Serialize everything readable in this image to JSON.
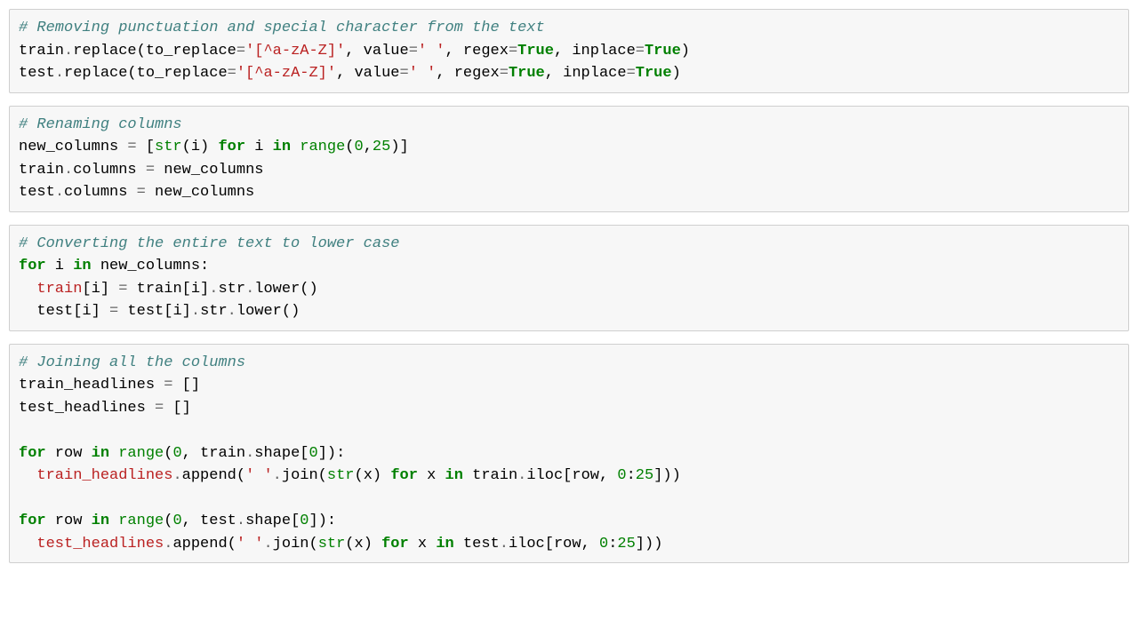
{
  "cells": [
    {
      "comment": "# Removing punctuation and special character from the text",
      "lines": [
        [
          {
            "t": "n",
            "v": "train"
          },
          {
            "t": "o",
            "v": "."
          },
          {
            "t": "n",
            "v": "replace(to_replace"
          },
          {
            "t": "o",
            "v": "="
          },
          {
            "t": "s",
            "v": "'[^a-zA-Z]'"
          },
          {
            "t": "n",
            "v": ", value"
          },
          {
            "t": "o",
            "v": "="
          },
          {
            "t": "s",
            "v": "' '"
          },
          {
            "t": "n",
            "v": ", regex"
          },
          {
            "t": "o",
            "v": "="
          },
          {
            "t": "kc",
            "v": "True"
          },
          {
            "t": "n",
            "v": ", inplace"
          },
          {
            "t": "o",
            "v": "="
          },
          {
            "t": "kc",
            "v": "True"
          },
          {
            "t": "n",
            "v": ")"
          }
        ],
        [
          {
            "t": "n",
            "v": "test"
          },
          {
            "t": "o",
            "v": "."
          },
          {
            "t": "n",
            "v": "replace(to_replace"
          },
          {
            "t": "o",
            "v": "="
          },
          {
            "t": "s",
            "v": "'[^a-zA-Z]'"
          },
          {
            "t": "n",
            "v": ", value"
          },
          {
            "t": "o",
            "v": "="
          },
          {
            "t": "s",
            "v": "' '"
          },
          {
            "t": "n",
            "v": ", regex"
          },
          {
            "t": "o",
            "v": "="
          },
          {
            "t": "kc",
            "v": "True"
          },
          {
            "t": "n",
            "v": ", inplace"
          },
          {
            "t": "o",
            "v": "="
          },
          {
            "t": "kc",
            "v": "True"
          },
          {
            "t": "n",
            "v": ")"
          }
        ]
      ]
    },
    {
      "comment": "# Renaming columns",
      "lines": [
        [
          {
            "t": "n",
            "v": "new_columns "
          },
          {
            "t": "o",
            "v": "="
          },
          {
            "t": "n",
            "v": " ["
          },
          {
            "t": "nb",
            "v": "str"
          },
          {
            "t": "n",
            "v": "(i) "
          },
          {
            "t": "k",
            "v": "for"
          },
          {
            "t": "n",
            "v": " i "
          },
          {
            "t": "k",
            "v": "in"
          },
          {
            "t": "n",
            "v": " "
          },
          {
            "t": "nb",
            "v": "range"
          },
          {
            "t": "n",
            "v": "("
          },
          {
            "t": "mi",
            "v": "0"
          },
          {
            "t": "n",
            "v": ","
          },
          {
            "t": "mi",
            "v": "25"
          },
          {
            "t": "n",
            "v": ")]"
          }
        ],
        [
          {
            "t": "n",
            "v": "train"
          },
          {
            "t": "o",
            "v": "."
          },
          {
            "t": "n",
            "v": "columns "
          },
          {
            "t": "o",
            "v": "="
          },
          {
            "t": "n",
            "v": " new_columns"
          }
        ],
        [
          {
            "t": "n",
            "v": "test"
          },
          {
            "t": "o",
            "v": "."
          },
          {
            "t": "n",
            "v": "columns "
          },
          {
            "t": "o",
            "v": "="
          },
          {
            "t": "n",
            "v": " new_columns"
          }
        ]
      ]
    },
    {
      "comment": "# Converting the entire text to lower case",
      "lines": [
        [
          {
            "t": "k",
            "v": "for"
          },
          {
            "t": "n",
            "v": " i "
          },
          {
            "t": "k",
            "v": "in"
          },
          {
            "t": "n",
            "v": " new_columns:"
          }
        ],
        [
          {
            "t": "n",
            "v": "  "
          },
          {
            "t": "err",
            "v": "train"
          },
          {
            "t": "n",
            "v": "[i] "
          },
          {
            "t": "o",
            "v": "="
          },
          {
            "t": "n",
            "v": " train[i]"
          },
          {
            "t": "o",
            "v": "."
          },
          {
            "t": "n",
            "v": "str"
          },
          {
            "t": "o",
            "v": "."
          },
          {
            "t": "n",
            "v": "lower()"
          }
        ],
        [
          {
            "t": "n",
            "v": "  test[i] "
          },
          {
            "t": "o",
            "v": "="
          },
          {
            "t": "n",
            "v": " test[i]"
          },
          {
            "t": "o",
            "v": "."
          },
          {
            "t": "n",
            "v": "str"
          },
          {
            "t": "o",
            "v": "."
          },
          {
            "t": "n",
            "v": "lower()"
          }
        ]
      ]
    },
    {
      "comment": "# Joining all the columns",
      "lines": [
        [
          {
            "t": "n",
            "v": "train_headlines "
          },
          {
            "t": "o",
            "v": "="
          },
          {
            "t": "n",
            "v": " []"
          }
        ],
        [
          {
            "t": "n",
            "v": "test_headlines "
          },
          {
            "t": "o",
            "v": "="
          },
          {
            "t": "n",
            "v": " []"
          }
        ],
        [],
        [
          {
            "t": "k",
            "v": "for"
          },
          {
            "t": "n",
            "v": " row "
          },
          {
            "t": "k",
            "v": "in"
          },
          {
            "t": "n",
            "v": " "
          },
          {
            "t": "nb",
            "v": "range"
          },
          {
            "t": "n",
            "v": "("
          },
          {
            "t": "mi",
            "v": "0"
          },
          {
            "t": "n",
            "v": ", train"
          },
          {
            "t": "o",
            "v": "."
          },
          {
            "t": "n",
            "v": "shape["
          },
          {
            "t": "mi",
            "v": "0"
          },
          {
            "t": "n",
            "v": "]):"
          }
        ],
        [
          {
            "t": "n",
            "v": "  "
          },
          {
            "t": "err",
            "v": "train_headlines"
          },
          {
            "t": "o",
            "v": "."
          },
          {
            "t": "n",
            "v": "append("
          },
          {
            "t": "s",
            "v": "' '"
          },
          {
            "t": "o",
            "v": "."
          },
          {
            "t": "n",
            "v": "join("
          },
          {
            "t": "nb",
            "v": "str"
          },
          {
            "t": "n",
            "v": "(x) "
          },
          {
            "t": "k",
            "v": "for"
          },
          {
            "t": "n",
            "v": " x "
          },
          {
            "t": "k",
            "v": "in"
          },
          {
            "t": "n",
            "v": " train"
          },
          {
            "t": "o",
            "v": "."
          },
          {
            "t": "n",
            "v": "iloc[row, "
          },
          {
            "t": "mi",
            "v": "0"
          },
          {
            "t": "n",
            "v": ":"
          },
          {
            "t": "mi",
            "v": "25"
          },
          {
            "t": "n",
            "v": "]))"
          }
        ],
        [],
        [
          {
            "t": "k",
            "v": "for"
          },
          {
            "t": "n",
            "v": " row "
          },
          {
            "t": "k",
            "v": "in"
          },
          {
            "t": "n",
            "v": " "
          },
          {
            "t": "nb",
            "v": "range"
          },
          {
            "t": "n",
            "v": "("
          },
          {
            "t": "mi",
            "v": "0"
          },
          {
            "t": "n",
            "v": ", test"
          },
          {
            "t": "o",
            "v": "."
          },
          {
            "t": "n",
            "v": "shape["
          },
          {
            "t": "mi",
            "v": "0"
          },
          {
            "t": "n",
            "v": "]):"
          }
        ],
        [
          {
            "t": "n",
            "v": "  "
          },
          {
            "t": "err",
            "v": "test_headlines"
          },
          {
            "t": "o",
            "v": "."
          },
          {
            "t": "n",
            "v": "append("
          },
          {
            "t": "s",
            "v": "' '"
          },
          {
            "t": "o",
            "v": "."
          },
          {
            "t": "n",
            "v": "join("
          },
          {
            "t": "nb",
            "v": "str"
          },
          {
            "t": "n",
            "v": "(x) "
          },
          {
            "t": "k",
            "v": "for"
          },
          {
            "t": "n",
            "v": " x "
          },
          {
            "t": "k",
            "v": "in"
          },
          {
            "t": "n",
            "v": " test"
          },
          {
            "t": "o",
            "v": "."
          },
          {
            "t": "n",
            "v": "iloc[row, "
          },
          {
            "t": "mi",
            "v": "0"
          },
          {
            "t": "n",
            "v": ":"
          },
          {
            "t": "mi",
            "v": "25"
          },
          {
            "t": "n",
            "v": "]))"
          }
        ]
      ]
    }
  ]
}
